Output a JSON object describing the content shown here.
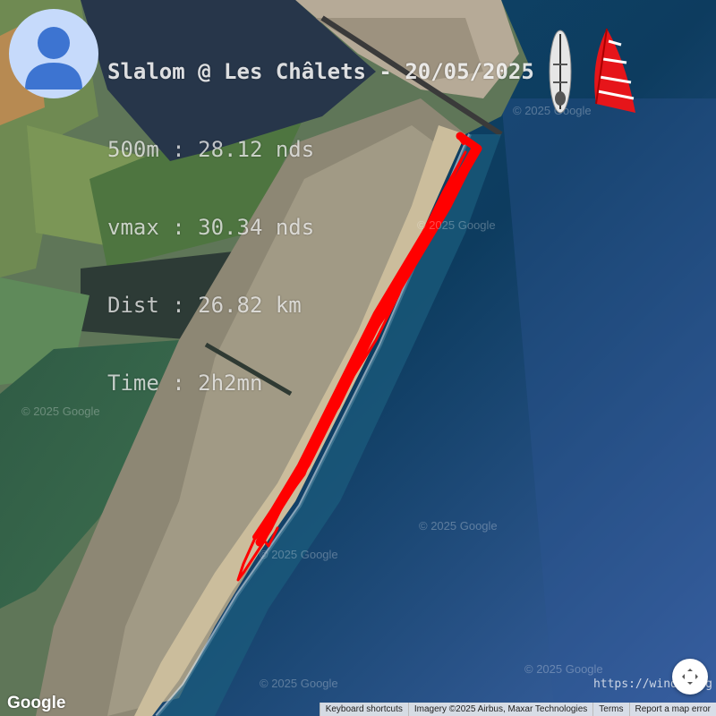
{
  "session": {
    "title": "Slalom @ Les Châlets - 20/05/2025",
    "line_500m": "500m : 28.12 nds",
    "line_vmax": "vmax : 30.34 nds",
    "line_dist": "Dist : 26.82 km",
    "line_time": "Time : 2h2mn"
  },
  "watermarks": [
    "© 2025 Google",
    "© 2025 Google",
    "© 2025 Google",
    "© 2025 Google",
    "© 2025 Google",
    "© 2025 Google",
    "© 2025 Google"
  ],
  "source_url": "https://windy.org",
  "map": {
    "logo": "Google",
    "keyboard_shortcuts": "Keyboard shortcuts",
    "imagery": "Imagery ©2025 Airbus, Maxar Technologies",
    "terms": "Terms",
    "report": "Report a map error"
  },
  "icons": {
    "avatar": "user-avatar-icon",
    "board": "windsurf-board-icon",
    "sail": "windsurf-sail-icon",
    "fullscreen": "fullscreen-icon"
  },
  "colors": {
    "track": "#ff0000",
    "sea": "#0e3b5c",
    "sand": "#b7a88a"
  }
}
